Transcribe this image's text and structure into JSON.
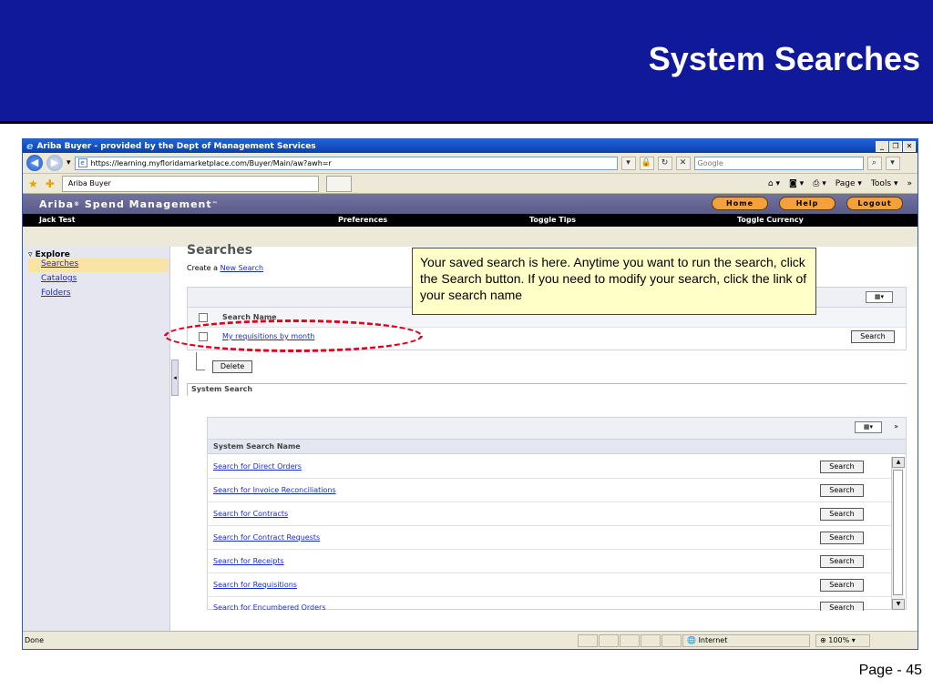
{
  "slide": {
    "title": "System Searches",
    "page_number": "Page - 45",
    "callout_text": "Your saved search is here.  Anytime you want to run the search, click the Search button.  If you need to modify your search, click the link of your search name"
  },
  "browser": {
    "window_title": "Ariba Buyer - provided by the Dept of Management Services",
    "address": "https://learning.myfloridamarketplace.com/Buyer/Main/aw?awh=r",
    "search_placeholder": "Google",
    "tab_label": "Ariba Buyer",
    "page_menu": "Page",
    "tools_menu": "Tools",
    "status_text": "Done",
    "zone_text": "Internet",
    "zoom_text": "100%"
  },
  "app": {
    "brand": "Ariba",
    "brand_suffix": "Spend Management",
    "header_buttons": [
      "Home",
      "Help",
      "Logout"
    ],
    "user": "Jack Test",
    "nav": [
      "Preferences",
      "Toggle Tips",
      "Toggle Currency"
    ]
  },
  "sidebar": {
    "section": "Explore",
    "items": [
      "Searches",
      "Catalogs",
      "Folders"
    ]
  },
  "main": {
    "heading": "Searches",
    "create_prefix": "Create a",
    "create_link": "New Search",
    "saved_table": {
      "column": "Search Name",
      "rows": [
        "My requisitions by month"
      ],
      "search_button": "Search",
      "delete_button": "Delete"
    },
    "system_section": "System Search",
    "system_table": {
      "column": "System Search Name",
      "rows": [
        "Search for Direct Orders",
        "Search for Invoice Reconciliations",
        "Search for Contracts",
        "Search for Contract Requests",
        "Search for Receipts",
        "Search for Requisitions",
        "Search for Encumbered Orders"
      ],
      "button": "Search"
    }
  },
  "colors": {
    "slide_header": "#0f199a",
    "callout_bg": "#ffffc8",
    "highlight_ellipse": "#e0001e",
    "header_pill": "#f4a13a"
  }
}
